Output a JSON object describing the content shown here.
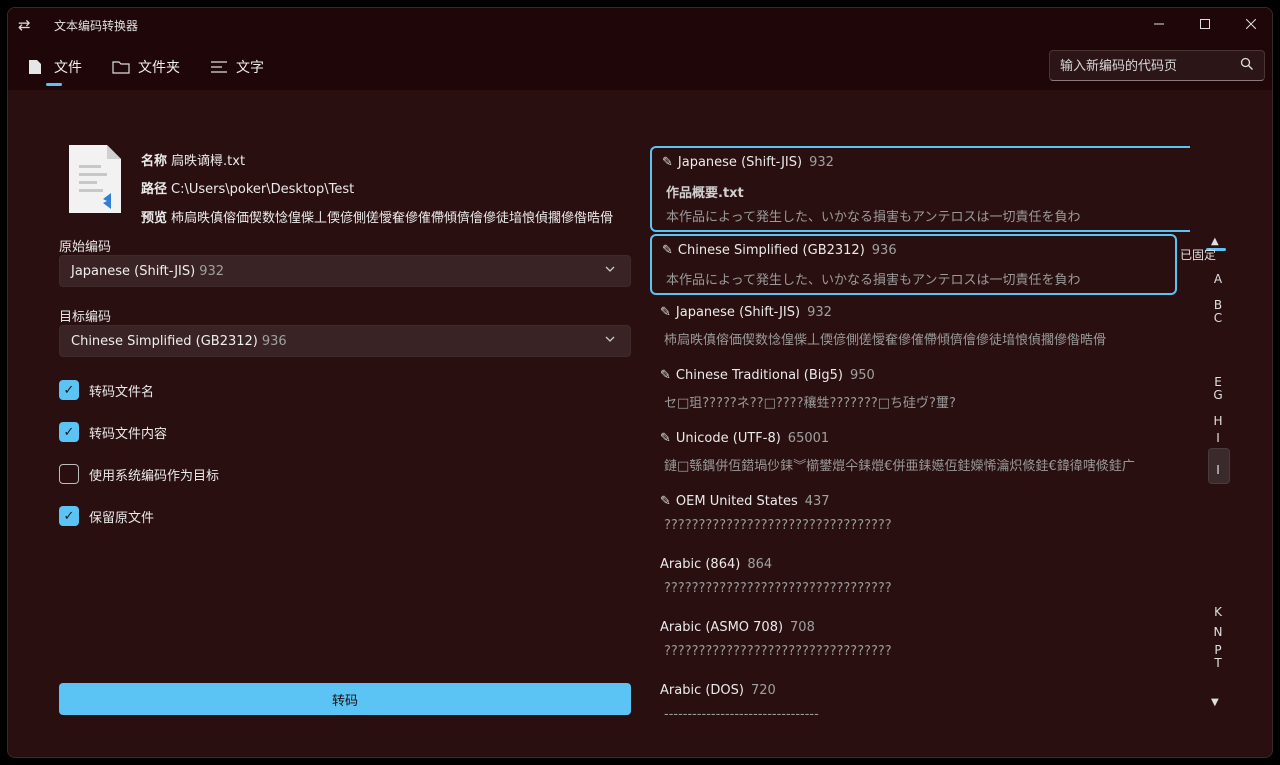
{
  "window": {
    "title": "文本编码转换器"
  },
  "nav": {
    "items": [
      {
        "label": "文件",
        "icon": "file-icon"
      },
      {
        "label": "文件夹",
        "icon": "folder-icon"
      },
      {
        "label": "文字",
        "icon": "text-icon"
      }
    ],
    "search_placeholder": "输入新编码的代码页"
  },
  "file_info": {
    "name_label": "名称",
    "name_value": "扃昳谪樳.txt",
    "path_label": "路径",
    "path_value": "C:\\Users\\poker\\Desktop\\Test",
    "preview_label": "预览",
    "preview_value": "柿扃昳傎傛価偰数惗偟偨丄偄偐側傞懓奞傪傕僀傾儕儈傪徒堷悢偵擱傪偺晧傦"
  },
  "source_encoding": {
    "label": "原始编码",
    "name": "Japanese (Shift-JIS)",
    "code": "932"
  },
  "target_encoding": {
    "label": "目标编码",
    "name": "Chinese Simplified (GB2312)",
    "code": "936"
  },
  "options": [
    {
      "label": "转码文件名",
      "checked": true
    },
    {
      "label": "转码文件内容",
      "checked": true
    },
    {
      "label": "使用系统编码作为目标",
      "checked": false
    },
    {
      "label": "保留原文件",
      "checked": true
    }
  ],
  "convert_button": "转码",
  "encodings": [
    {
      "name": "Japanese (Shift-JIS)",
      "code": "932",
      "pinned": true,
      "selected": true,
      "filename": "作品概要.txt",
      "preview": "本作品によって発生した、いかなる損害もアンテロスは一切責任を負わ"
    },
    {
      "name": "Chinese Simplified (GB2312)",
      "code": "936",
      "pinned": true,
      "selected": true,
      "filename": "",
      "preview": "本作品によって発生した、いかなる損害もアンテロスは一切責任を負わ"
    },
    {
      "name": "Japanese (Shift-JIS)",
      "code": "932",
      "pinned": true,
      "selected": false,
      "filename": "",
      "preview": "柿扃昳傎傛価偰数惗偟偨丄偄偐側傞懓奞傪傕僀傾儕儈傪徒堷悢偵擱傪偺晧傦"
    },
    {
      "name": "Chinese Traditional (Big5)",
      "code": "950",
      "pinned": true,
      "selected": false,
      "filename": "",
      "preview": "セ□珇?????ネ??□????穰甡???????□ち硅ヴ?璽?"
    },
    {
      "name": "Unicode (UTF-8)",
      "code": "65001",
      "pinned": true,
      "selected": false,
      "filename": "",
      "preview": "鏈□綔鍝併仾鍣堝仯銇︾櫤鐢熴仐銇熴€併亜銇嬨仾銈嬫悕瀹炽倐銈€鍏徫嗐倐銈广"
    },
    {
      "name": "OEM United States",
      "code": "437",
      "pinned": true,
      "selected": false,
      "filename": "",
      "preview": "?????????????????????????????????"
    },
    {
      "name": "Arabic (864)",
      "code": "864",
      "pinned": false,
      "selected": false,
      "filename": "",
      "preview": "?????????????????????????????????"
    },
    {
      "name": "Arabic (ASMO 708)",
      "code": "708",
      "pinned": false,
      "selected": false,
      "filename": "",
      "preview": "?????????????????????????????????"
    },
    {
      "name": "Arabic (DOS)",
      "code": "720",
      "pinned": false,
      "selected": false,
      "filename": "",
      "preview": "---------------------------------"
    }
  ],
  "index": {
    "pinned_label": "已固定",
    "letters": [
      "A",
      "B",
      "C",
      "E",
      "G",
      "H",
      "I",
      "I",
      "K",
      "N",
      "P",
      "T"
    ]
  }
}
